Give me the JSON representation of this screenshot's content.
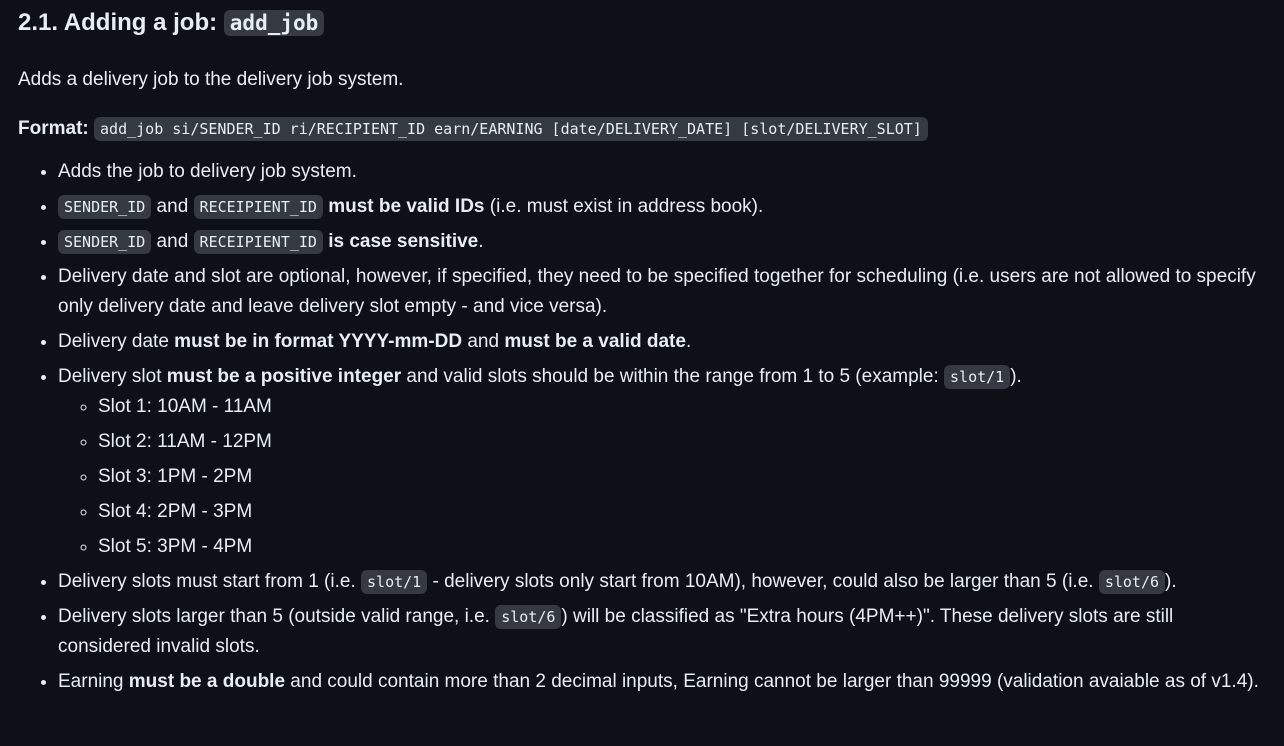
{
  "heading": {
    "text": "2.1. Adding a job: ",
    "code": "add_job"
  },
  "intro": "Adds a delivery job to the delivery job system.",
  "format": {
    "label": "Format:",
    "code": "add_job si/SENDER_ID ri/RECIPIENT_ID earn/EARNING [date/DELIVERY_DATE] [slot/DELIVERY_SLOT]"
  },
  "bullets": {
    "b1": "Adds the job to delivery job system.",
    "b2": {
      "code1": "SENDER_ID",
      "and": " and ",
      "code2": "RECEIPIENT_ID",
      "bold": "must be valid IDs",
      "rest": " (i.e. must exist in address book)."
    },
    "b3": {
      "code1": "SENDER_ID",
      "and": " and ",
      "code2": "RECEIPIENT_ID",
      "bold": "is case sensitive",
      "rest": "."
    },
    "b4": "Delivery date and slot are optional, however, if specified, they need to be specified together for scheduling (i.e. users are not allowed to specify only delivery date and leave delivery slot empty - and vice versa).",
    "b5": {
      "t1": "Delivery date ",
      "bold1": "must be in format YYYY-mm-DD",
      "t2": " and ",
      "bold2": "must be a valid date",
      "t3": "."
    },
    "b6": {
      "t1": "Delivery slot ",
      "bold": "must be a positive integer",
      "t2": " and valid slots should be within the range from 1 to 5 (example: ",
      "code": "slot/1",
      "t3": ")."
    },
    "slots": [
      "Slot 1: 10AM - 11AM",
      "Slot 2: 11AM - 12PM",
      "Slot 3: 1PM - 2PM",
      "Slot 4: 2PM - 3PM",
      "Slot 5: 3PM - 4PM"
    ],
    "b7": {
      "t1": "Delivery slots must start from 1 (i.e. ",
      "code1": "slot/1",
      "t2": " - delivery slots only start from 10AM), however, could also be larger than 5 (i.e. ",
      "code2": "slot/6",
      "t3": ")."
    },
    "b8": {
      "t1": "Delivery slots larger than 5 (outside valid range, i.e. ",
      "code": "slot/6",
      "t2": ") will be classified as \"Extra hours (4PM++)\". These delivery slots are still considered invalid slots."
    },
    "b9": {
      "t1": "Earning ",
      "bold": "must be a double",
      "t2": " and could contain more than 2 decimal inputs, Earning cannot be larger than 99999 (validation avaiable as of v1.4)."
    }
  }
}
